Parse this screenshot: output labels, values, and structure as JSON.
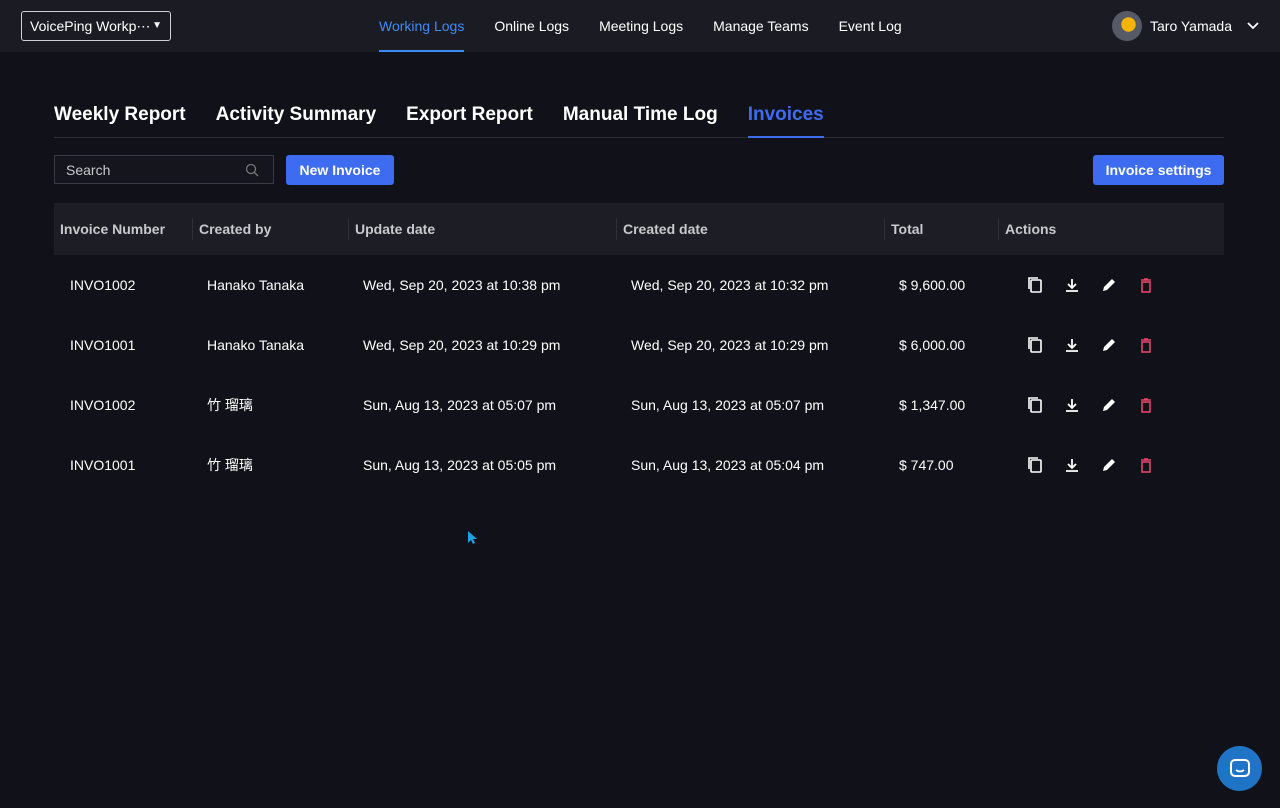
{
  "workspace": "VoicePing Workp⋯",
  "nav": [
    "Working Logs",
    "Online Logs",
    "Meeting Logs",
    "Manage Teams",
    "Event Log"
  ],
  "user": {
    "name": "Taro Yamada"
  },
  "tabs": [
    "Weekly Report",
    "Activity Summary",
    "Export Report",
    "Manual Time Log",
    "Invoices"
  ],
  "search": {
    "placeholder": "Search"
  },
  "buttons": {
    "new_invoice": "New Invoice",
    "invoice_settings": "Invoice settings"
  },
  "columns": [
    "Invoice Number",
    "Created by",
    "Update date",
    "Created date",
    "Total",
    "Actions"
  ],
  "rows": [
    {
      "number": "INVO1002",
      "created_by": "Hanako Tanaka",
      "updated": "Wed, Sep 20, 2023 at 10:38 pm",
      "created": "Wed, Sep 20, 2023 at 10:32 pm",
      "total": "$ 9,600.00"
    },
    {
      "number": "INVO1001",
      "created_by": "Hanako Tanaka",
      "updated": "Wed, Sep 20, 2023 at 10:29 pm",
      "created": "Wed, Sep 20, 2023 at 10:29 pm",
      "total": "$ 6,000.00"
    },
    {
      "number": "INVO1002",
      "created_by": "竹 瑠璃",
      "updated": "Sun, Aug 13, 2023 at 05:07 pm",
      "created": "Sun, Aug 13, 2023 at 05:07 pm",
      "total": "$ 1,347.00"
    },
    {
      "number": "INVO1001",
      "created_by": "竹 瑠璃",
      "updated": "Sun, Aug 13, 2023 at 05:05 pm",
      "created": "Sun, Aug 13, 2023 at 05:04 pm",
      "total": "$ 747.00"
    }
  ]
}
